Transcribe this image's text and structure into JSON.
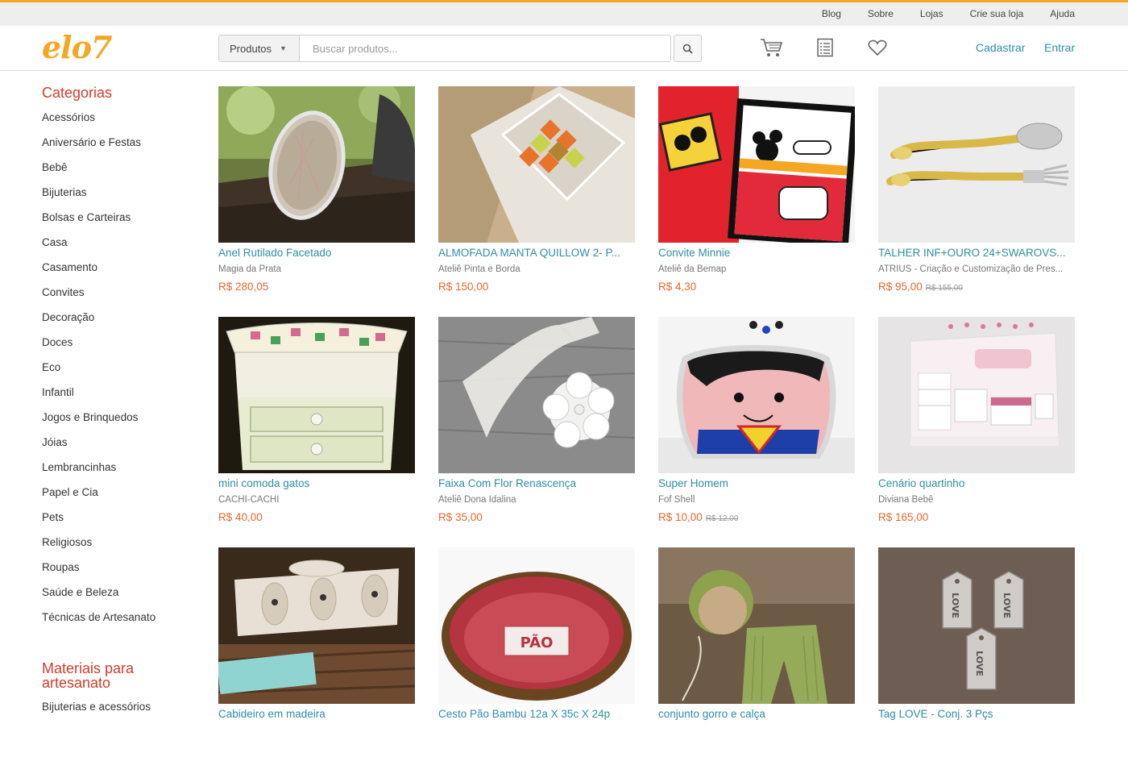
{
  "topnav": [
    "Blog",
    "Sobre",
    "Lojas",
    "Crie sua loja",
    "Ajuda"
  ],
  "header": {
    "logo": "elo7",
    "search_category": "Produtos",
    "search_placeholder": "Buscar produtos...",
    "register": "Cadastrar",
    "login": "Entrar"
  },
  "sidebar": {
    "categories_title": "Categorias",
    "categories": [
      "Acessórios",
      "Aniversário e Festas",
      "Bebê",
      "Bijuterias",
      "Bolsas e Carteiras",
      "Casa",
      "Casamento",
      "Convites",
      "Decoração",
      "Doces",
      "Eco",
      "Infantil",
      "Jogos e Brinquedos",
      "Jóias",
      "Lembrancinhas",
      "Papel e Cia",
      "Pets",
      "Religiosos",
      "Roupas",
      "Saúde e Beleza",
      "Técnicas de Artesanato"
    ],
    "materials_title": "Materiais para artesanato",
    "materials": [
      "Bijuterias e acessórios"
    ]
  },
  "products": [
    {
      "name": "Anel Rutilado Facetado",
      "store": "Magia da Prata",
      "price": "R$ 280,05",
      "old_price": ""
    },
    {
      "name": "ALMOFADA MANTA QUILLOW 2- P...",
      "store": "Ateliê Pinta e Borda",
      "price": "R$ 150,00",
      "old_price": ""
    },
    {
      "name": "Convite Minnie",
      "store": "Ateliê da Bemap",
      "price": "R$ 4,30",
      "old_price": ""
    },
    {
      "name": "TALHER INF+OURO 24+SWAROVS...",
      "store": "ATRIUS - Criação e Customização de Pres...",
      "price": "R$ 95,00",
      "old_price": "R$ 155,00"
    },
    {
      "name": "mini comoda gatos",
      "store": "CACHI-CACHI",
      "price": "R$ 40,00",
      "old_price": ""
    },
    {
      "name": "Faixa Com Flor Renascença",
      "store": "Ateliê Dona Idalina",
      "price": "R$ 35,00",
      "old_price": ""
    },
    {
      "name": "Super Homem",
      "store": "Fof Shell",
      "price": "R$ 10,00",
      "old_price": "R$ 12,00"
    },
    {
      "name": "Cenário quartinho",
      "store": "Diviana Bebê",
      "price": "R$ 165,00",
      "old_price": ""
    },
    {
      "name": "Cabideiro em madeira",
      "store": "",
      "price": "",
      "old_price": ""
    },
    {
      "name": "Cesto Pão Bambu 12a X 35c X 24p",
      "store": "",
      "price": "",
      "old_price": ""
    },
    {
      "name": "conjunto gorro e calça",
      "store": "",
      "price": "",
      "old_price": ""
    },
    {
      "name": "Tag LOVE - Conj. 3 Pçs",
      "store": "",
      "price": "",
      "old_price": ""
    }
  ],
  "colors": {
    "brand": "#f5a623",
    "link": "#2d8ea8",
    "price": "#e8672e",
    "category_title": "#d23c2a"
  }
}
